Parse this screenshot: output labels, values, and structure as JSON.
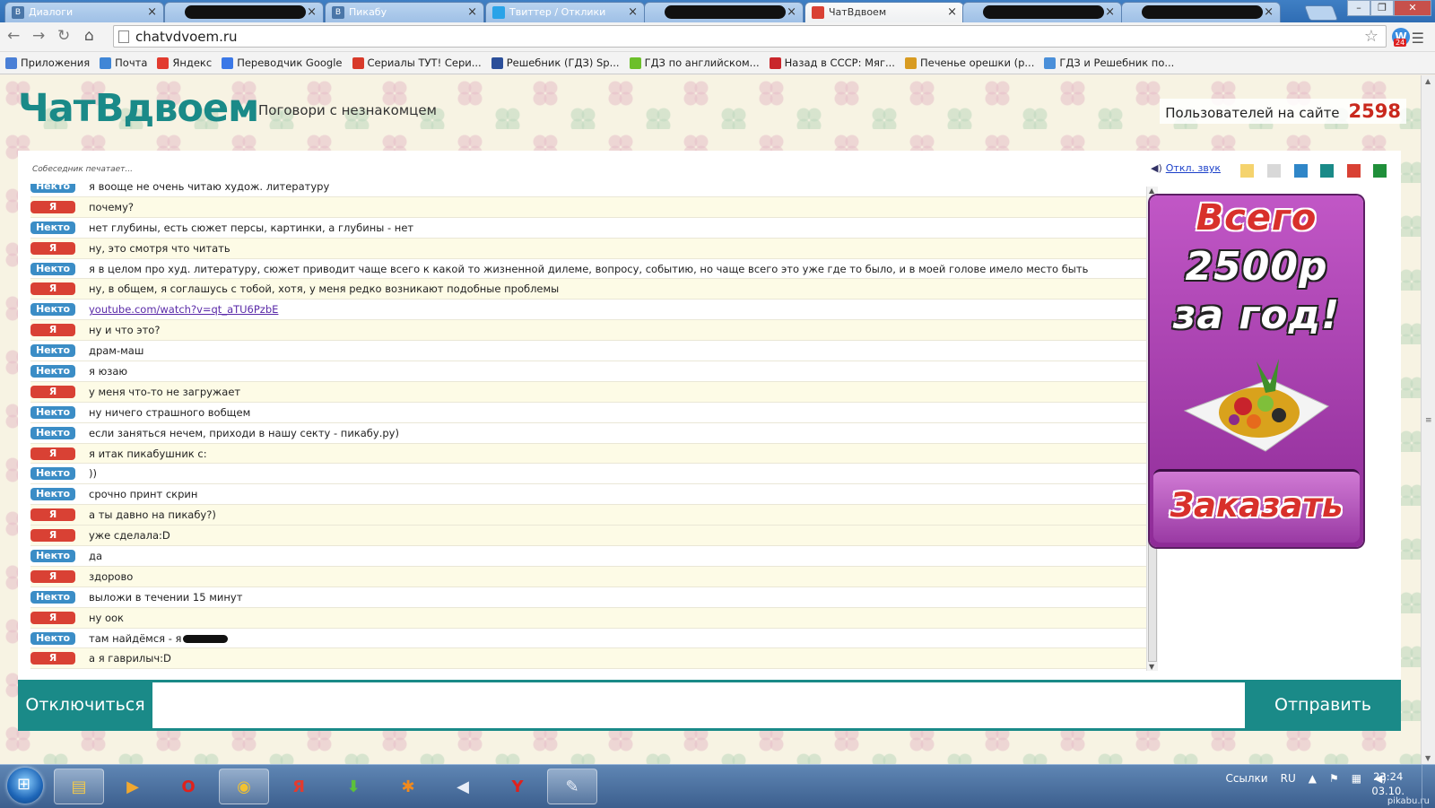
{
  "browser": {
    "tabs": [
      {
        "title": "Диалоги",
        "icon": "vk-icon",
        "active": false,
        "redacted": false
      },
      {
        "title": "",
        "icon": "redacted-icon",
        "active": false,
        "redacted": true
      },
      {
        "title": "Пикабу",
        "icon": "vk-icon",
        "active": false,
        "redacted": false
      },
      {
        "title": "Твиттер / Отклики",
        "icon": "twitter-icon",
        "active": false,
        "redacted": false
      },
      {
        "title": "",
        "icon": "redacted-icon",
        "active": false,
        "redacted": true
      },
      {
        "title": "ЧатВдвоем",
        "icon": "chat-bubble-icon",
        "active": true,
        "redacted": false
      },
      {
        "title": "",
        "icon": "redacted-icon",
        "active": false,
        "redacted": true
      },
      {
        "title": "",
        "icon": "redacted-icon",
        "active": false,
        "redacted": true
      }
    ],
    "url": "chatvdvoem.ru",
    "extension_badge": "24",
    "bookmarks": [
      {
        "label": "Приложения",
        "icon": "apps-grid-icon",
        "color": "#4a7fd6"
      },
      {
        "label": "Почта",
        "icon": "mail-icon",
        "color": "#3f86d6"
      },
      {
        "label": "Яндекс",
        "icon": "yandex-icon",
        "color": "#e23b2f"
      },
      {
        "label": "Переводчик Google",
        "icon": "translate-icon",
        "color": "#3b78e7"
      },
      {
        "label": "Сериалы ТУТ! Сери...",
        "icon": "tv-icon",
        "color": "#d83a2a"
      },
      {
        "label": "Решебник (ГДЗ) Sp...",
        "icon": "script-s-icon",
        "color": "#2b4f9a"
      },
      {
        "label": "ГДЗ по английском...",
        "icon": "gdz-icon",
        "color": "#6cbf2a"
      },
      {
        "label": "Назад в СССР: Мяг...",
        "icon": "ussr-icon",
        "color": "#c9262b"
      },
      {
        "label": "Печенье орешки (р...",
        "icon": "flag-icon",
        "color": "#d89b21"
      },
      {
        "label": "ГДЗ и Решебник по...",
        "icon": "gdz-cloud-icon",
        "color": "#4a8fd9"
      }
    ]
  },
  "site": {
    "logo": "ЧатВдвоем",
    "tagline": "Поговори с незнакомцем",
    "online_label": "Пользователей на сайте",
    "online_count": "2598",
    "typing_status": "Собеседник печатает...",
    "sound_toggle": "Откл. звук",
    "theme_colors": [
      "#f5d36d",
      "#d8d8d8",
      "#2f86c8",
      "#1a8a88",
      "#d94134",
      "#1f8f3a"
    ],
    "labels": {
      "them": "Некто",
      "me": "Я"
    },
    "messages": [
      {
        "from": "them",
        "text": "я вооще не очень читаю худож. литературу"
      },
      {
        "from": "me",
        "text": "почему?"
      },
      {
        "from": "them",
        "text": "нет глубины, есть сюжет персы, картинки, а глубины - нет"
      },
      {
        "from": "me",
        "text": "ну, это смотря что читать"
      },
      {
        "from": "them",
        "text": "я в целом про худ. литературу, сюжет приводит чаще всего к какой то жизненной дилеме, вопросу, событию, но чаще всего это уже где то было, и в моей голове имело место быть"
      },
      {
        "from": "me",
        "text": "ну, в общем, я соглашусь с тобой, хотя, у меня редко возникают подобные проблемы"
      },
      {
        "from": "them",
        "text": "youtube.com/watch?v=qt_aTU6PzbE",
        "link": true
      },
      {
        "from": "me",
        "text": "ну и что это?"
      },
      {
        "from": "them",
        "text": "драм-маш"
      },
      {
        "from": "them",
        "text": "я юзаю"
      },
      {
        "from": "me",
        "text": "у меня что-то не загружает"
      },
      {
        "from": "them",
        "text": "ну ничего страшного вобщем"
      },
      {
        "from": "them",
        "text": "если заняться нечем, приходи в нашу секту - пикабу.ру)"
      },
      {
        "from": "me",
        "text": "я итак пикабушник с:"
      },
      {
        "from": "them",
        "text": "))"
      },
      {
        "from": "them",
        "text": "срочно принт скрин"
      },
      {
        "from": "me",
        "text": "а ты давно на пикабу?)"
      },
      {
        "from": "me",
        "text": "уже сделала:D"
      },
      {
        "from": "them",
        "text": "да"
      },
      {
        "from": "me",
        "text": "здорово"
      },
      {
        "from": "them",
        "text": "выложи в течении 15 минут"
      },
      {
        "from": "me",
        "text": "ну оок"
      },
      {
        "from": "them",
        "text": "там найдёмся - я ",
        "redacted_tail": true
      },
      {
        "from": "me",
        "text": "а я гаврилыч:D"
      }
    ],
    "ad": {
      "line1": "Всего",
      "line2": "2500р",
      "line3": "за год!",
      "button": "Заказать"
    },
    "disconnect_label": "Отключиться",
    "input_placeholder": "",
    "send_label": "Отправить"
  },
  "taskbar": {
    "apps": [
      {
        "name": "explorer",
        "icon": "folder-icon",
        "glyph": "▤",
        "color": "#f2c94c",
        "open": true
      },
      {
        "name": "media-player",
        "icon": "media-player-icon",
        "glyph": "▶",
        "color": "#f0a830",
        "open": false
      },
      {
        "name": "opera",
        "icon": "opera-icon",
        "glyph": "O",
        "color": "#e0211c",
        "open": false
      },
      {
        "name": "chrome",
        "icon": "chrome-icon",
        "glyph": "◉",
        "color": "#f2c230",
        "open": true
      },
      {
        "name": "yandex-browser",
        "icon": "yandex-browser-icon",
        "glyph": "Я",
        "color": "#e23b2f",
        "open": false
      },
      {
        "name": "downloader",
        "icon": "download-icon",
        "glyph": "⬇",
        "color": "#5cc13a",
        "open": false
      },
      {
        "name": "avast",
        "icon": "avast-icon",
        "glyph": "✱",
        "color": "#f28a1c",
        "open": false
      },
      {
        "name": "volume-app",
        "icon": "speaker-icon",
        "glyph": "◀",
        "color": "#e8eef8",
        "open": false
      },
      {
        "name": "yandex",
        "icon": "yandex-y-icon",
        "glyph": "Y",
        "color": "#e0211c",
        "open": false
      },
      {
        "name": "paint",
        "icon": "paint-icon",
        "glyph": "✎",
        "color": "#e8eef8",
        "open": true
      }
    ],
    "tray_links": "Ссылки",
    "language": "RU",
    "time": "23:24",
    "date": "03.10.",
    "watermark": "pikabu.ru"
  }
}
